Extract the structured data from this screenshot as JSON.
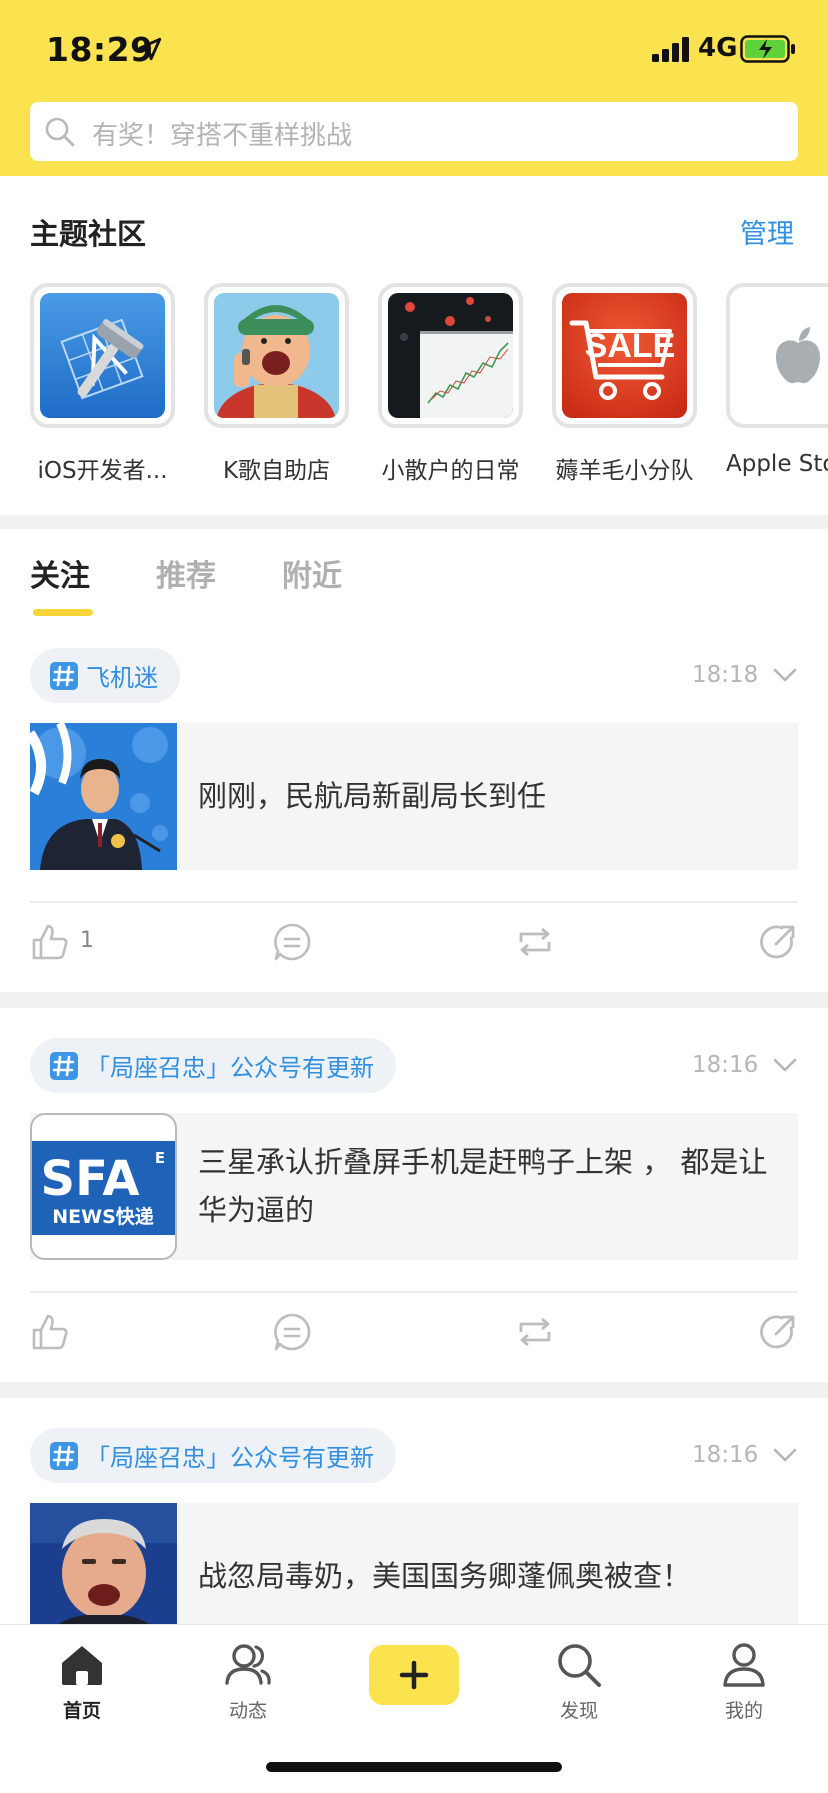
{
  "status_bar": {
    "time": "18:29",
    "network": "4G",
    "colors": {
      "battery_fill": "#5fd13a"
    }
  },
  "search": {
    "placeholder": "有奖！穿搭不重样挑战"
  },
  "communities": {
    "title": "主题社区",
    "manage_label": "管理",
    "items": [
      {
        "label": "iOS开发者...",
        "icon": "xcode-icon"
      },
      {
        "label": "K歌自助店",
        "icon": "singing-cartoon-image"
      },
      {
        "label": "小散户的日常",
        "icon": "stock-chart-image"
      },
      {
        "label": "薅羊毛小分队",
        "icon": "sale-cart-icon"
      },
      {
        "label": "Apple Sto",
        "icon": "apple-logo-icon"
      }
    ]
  },
  "feed_tabs": [
    {
      "label": "关注",
      "active": true
    },
    {
      "label": "推荐",
      "active": false
    },
    {
      "label": "附近",
      "active": false
    }
  ],
  "posts": [
    {
      "topic": "飞机迷",
      "time": "18:18",
      "title": "刚刚，民航局新副局长到任",
      "thumbnail": "official-speaking-photo",
      "like_count": "1"
    },
    {
      "topic": "「局座召忠」公众号有更新",
      "time": "18:16",
      "title": "三星承认折叠屏手机是赶鸭子上架 ， 都是让华为逼的",
      "thumbnail": "sfa-news-logo",
      "logo_text": {
        "main": "SFA",
        "sup": "E",
        "sub": "NEWS快递"
      },
      "like_count": ""
    },
    {
      "topic": "「局座召忠」公众号有更新",
      "time": "18:16",
      "title": "战忽局毒奶，美国国务卿蓬佩奥被查！",
      "thumbnail": "politician-photo",
      "like_count": ""
    }
  ],
  "tab_bar": {
    "items": [
      {
        "label": "首页",
        "icon": "home-icon",
        "active": true
      },
      {
        "label": "动态",
        "icon": "people-icon",
        "active": false
      },
      {
        "label": "发现",
        "icon": "search-icon",
        "active": false
      },
      {
        "label": "我的",
        "icon": "profile-icon",
        "active": false
      }
    ],
    "compose_icon": "plus-icon"
  },
  "colors": {
    "brand_yellow": "#fae34f",
    "link_blue": "#2f8fe0",
    "tab_indicator": "#fad53a"
  }
}
